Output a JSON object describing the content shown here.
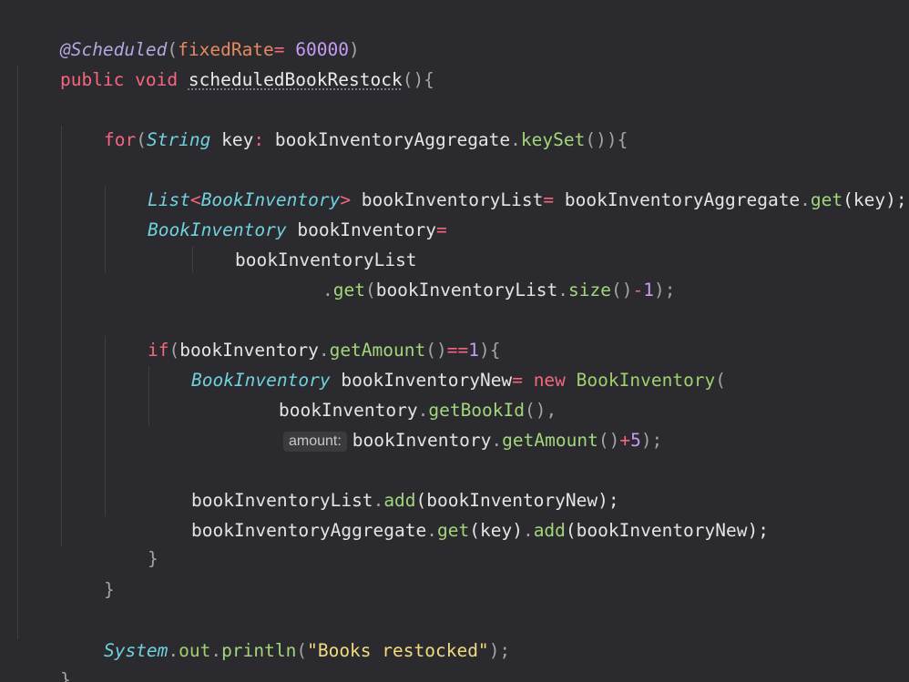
{
  "code": {
    "l1": {
      "annotation": "@Scheduled",
      "p_open": "(",
      "param": "fixedRate",
      "eq": "=",
      "sp": " ",
      "value": "60000",
      "p_close": ")"
    },
    "l2": {
      "kw_public": "public",
      "kw_void": "void",
      "method": "scheduledBookRestock",
      "tail": "(){"
    },
    "l4": {
      "kw_for": "for",
      "p1": "(",
      "type": "String",
      "var": " key",
      "colon": ":",
      "coll": "bookInventoryAggregate",
      "dot": ".",
      "call": "keySet",
      "tail": "()){"
    },
    "l6": {
      "type_list": "List",
      "lt": "<",
      "type_book": "BookInventory",
      "gt": ">",
      "var": " bookInventoryList",
      "eq": "=",
      "obj": "bookInventoryAggregate",
      "dot": ".",
      "call": "get",
      "args": "(key);"
    },
    "l7": {
      "type": "BookInventory",
      "var": " bookInventory",
      "eq": "="
    },
    "l8": {
      "var": "bookInventoryList"
    },
    "l9": {
      "dot": ".",
      "call": "get",
      "p1": "(",
      "obj": "bookInventoryList",
      "dot2": ".",
      "call2": "size",
      "p2": "()",
      "minus": "-",
      "num": "1",
      "tail": ");"
    },
    "l11": {
      "kw_if": "if",
      "p1": "(",
      "obj": "bookInventory",
      "dot": ".",
      "call": "getAmount",
      "p2": "()",
      "op": "==",
      "num": "1",
      "tail": "){"
    },
    "l12": {
      "type": "BookInventory",
      "var": " bookInventoryNew",
      "eq": "=",
      "kw_new": "new",
      "cls": "BookInventory",
      "p1": "("
    },
    "l13": {
      "obj": "bookInventory",
      "dot": ".",
      "call": "getBookId",
      "tail": "(),"
    },
    "l14": {
      "hint": "amount:",
      "obj": "bookInventory",
      "dot": ".",
      "call": "getAmount",
      "p1": "()",
      "plus": "+",
      "num": "5",
      "tail": ");"
    },
    "l16": {
      "obj": "bookInventoryList",
      "dot": ".",
      "call": "add",
      "args": "(bookInventoryNew);"
    },
    "l17": {
      "obj": "bookInventoryAggregate",
      "dot": ".",
      "call": "get",
      "args": "(key)",
      "dot2": ".",
      "call2": "add",
      "args2": "(bookInventoryNew);"
    },
    "l18": {
      "brace": "}"
    },
    "l19": {
      "brace": "}"
    },
    "l21": {
      "type": "System",
      "dot": ".",
      "field": "out",
      "dot2": ".",
      "call": "println",
      "p1": "(",
      "str": "\"Books restocked\"",
      "tail": ");"
    },
    "l22": {
      "brace": "}"
    }
  }
}
